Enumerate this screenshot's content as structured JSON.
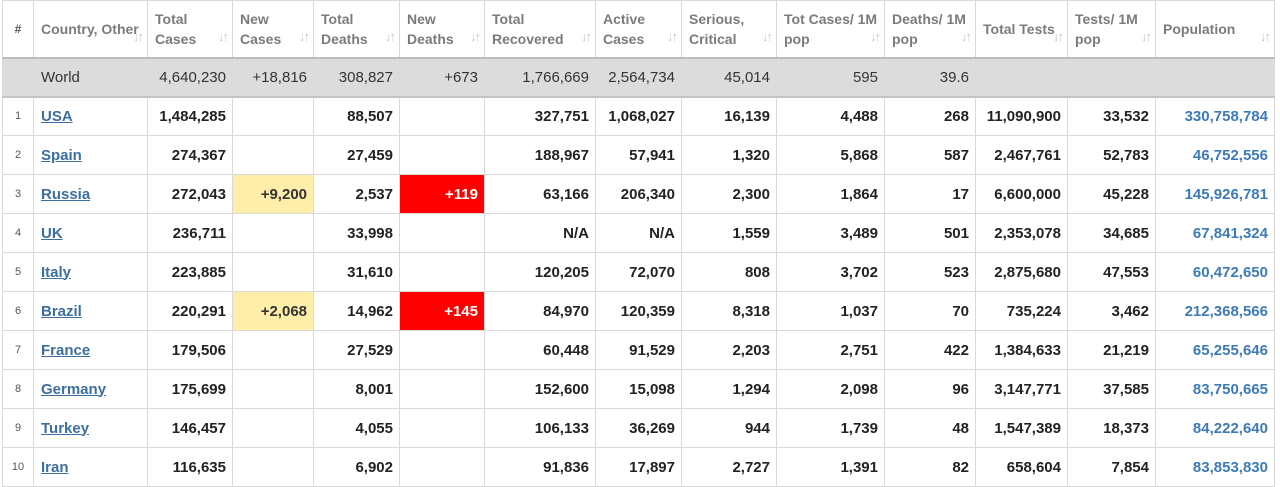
{
  "headers": [
    {
      "key": "num",
      "label": "#"
    },
    {
      "key": "country",
      "label": "Country, Other"
    },
    {
      "key": "total_cases",
      "label": "Total Cases"
    },
    {
      "key": "new_cases",
      "label": "New Cases"
    },
    {
      "key": "total_deaths",
      "label": "Total Deaths"
    },
    {
      "key": "new_deaths",
      "label": "New Deaths"
    },
    {
      "key": "total_recovered",
      "label": "Total Recovered"
    },
    {
      "key": "active_cases",
      "label": "Active Cases"
    },
    {
      "key": "serious_critical",
      "label": "Serious, Critical"
    },
    {
      "key": "tot_cases_1m",
      "label": "Tot Cases/ 1M pop"
    },
    {
      "key": "deaths_1m",
      "label": "Deaths/ 1M pop"
    },
    {
      "key": "total_tests",
      "label": "Total Tests"
    },
    {
      "key": "tests_1m",
      "label": "Tests/ 1M pop"
    },
    {
      "key": "population",
      "label": "Population"
    }
  ],
  "world": {
    "country": "World",
    "total_cases": "4,640,230",
    "new_cases": "+18,816",
    "total_deaths": "308,827",
    "new_deaths": "+673",
    "total_recovered": "1,766,669",
    "active_cases": "2,564,734",
    "serious_critical": "45,014",
    "tot_cases_1m": "595",
    "deaths_1m": "39.6",
    "total_tests": "",
    "tests_1m": "",
    "population": ""
  },
  "rows": [
    {
      "num": "1",
      "country": "USA",
      "total_cases": "1,484,285",
      "new_cases": "",
      "total_deaths": "88,507",
      "new_deaths": "",
      "total_recovered": "327,751",
      "active_cases": "1,068,027",
      "serious_critical": "16,139",
      "tot_cases_1m": "4,488",
      "deaths_1m": "268",
      "total_tests": "11,090,900",
      "tests_1m": "33,532",
      "population": "330,758,784"
    },
    {
      "num": "2",
      "country": "Spain",
      "total_cases": "274,367",
      "new_cases": "",
      "total_deaths": "27,459",
      "new_deaths": "",
      "total_recovered": "188,967",
      "active_cases": "57,941",
      "serious_critical": "1,320",
      "tot_cases_1m": "5,868",
      "deaths_1m": "587",
      "total_tests": "2,467,761",
      "tests_1m": "52,783",
      "population": "46,752,556"
    },
    {
      "num": "3",
      "country": "Russia",
      "total_cases": "272,043",
      "new_cases": "+9,200",
      "total_deaths": "2,537",
      "new_deaths": "+119",
      "total_recovered": "63,166",
      "active_cases": "206,340",
      "serious_critical": "2,300",
      "tot_cases_1m": "1,864",
      "deaths_1m": "17",
      "total_tests": "6,600,000",
      "tests_1m": "45,228",
      "population": "145,926,781"
    },
    {
      "num": "4",
      "country": "UK",
      "total_cases": "236,711",
      "new_cases": "",
      "total_deaths": "33,998",
      "new_deaths": "",
      "total_recovered": "N/A",
      "active_cases": "N/A",
      "serious_critical": "1,559",
      "tot_cases_1m": "3,489",
      "deaths_1m": "501",
      "total_tests": "2,353,078",
      "tests_1m": "34,685",
      "population": "67,841,324"
    },
    {
      "num": "5",
      "country": "Italy",
      "total_cases": "223,885",
      "new_cases": "",
      "total_deaths": "31,610",
      "new_deaths": "",
      "total_recovered": "120,205",
      "active_cases": "72,070",
      "serious_critical": "808",
      "tot_cases_1m": "3,702",
      "deaths_1m": "523",
      "total_tests": "2,875,680",
      "tests_1m": "47,553",
      "population": "60,472,650"
    },
    {
      "num": "6",
      "country": "Brazil",
      "total_cases": "220,291",
      "new_cases": "+2,068",
      "total_deaths": "14,962",
      "new_deaths": "+145",
      "total_recovered": "84,970",
      "active_cases": "120,359",
      "serious_critical": "8,318",
      "tot_cases_1m": "1,037",
      "deaths_1m": "70",
      "total_tests": "735,224",
      "tests_1m": "3,462",
      "population": "212,368,566"
    },
    {
      "num": "7",
      "country": "France",
      "total_cases": "179,506",
      "new_cases": "",
      "total_deaths": "27,529",
      "new_deaths": "",
      "total_recovered": "60,448",
      "active_cases": "91,529",
      "serious_critical": "2,203",
      "tot_cases_1m": "2,751",
      "deaths_1m": "422",
      "total_tests": "1,384,633",
      "tests_1m": "21,219",
      "population": "65,255,646"
    },
    {
      "num": "8",
      "country": "Germany",
      "total_cases": "175,699",
      "new_cases": "",
      "total_deaths": "8,001",
      "new_deaths": "",
      "total_recovered": "152,600",
      "active_cases": "15,098",
      "serious_critical": "1,294",
      "tot_cases_1m": "2,098",
      "deaths_1m": "96",
      "total_tests": "3,147,771",
      "tests_1m": "37,585",
      "population": "83,750,665"
    },
    {
      "num": "9",
      "country": "Turkey",
      "total_cases": "146,457",
      "new_cases": "",
      "total_deaths": "4,055",
      "new_deaths": "",
      "total_recovered": "106,133",
      "active_cases": "36,269",
      "serious_critical": "944",
      "tot_cases_1m": "1,739",
      "deaths_1m": "48",
      "total_tests": "1,547,389",
      "tests_1m": "18,373",
      "population": "84,222,640"
    },
    {
      "num": "10",
      "country": "Iran",
      "total_cases": "116,635",
      "new_cases": "",
      "total_deaths": "6,902",
      "new_deaths": "",
      "total_recovered": "91,836",
      "active_cases": "17,897",
      "serious_critical": "2,727",
      "tot_cases_1m": "1,391",
      "deaths_1m": "82",
      "total_tests": "658,604",
      "tests_1m": "7,854",
      "population": "83,853,830"
    }
  ]
}
